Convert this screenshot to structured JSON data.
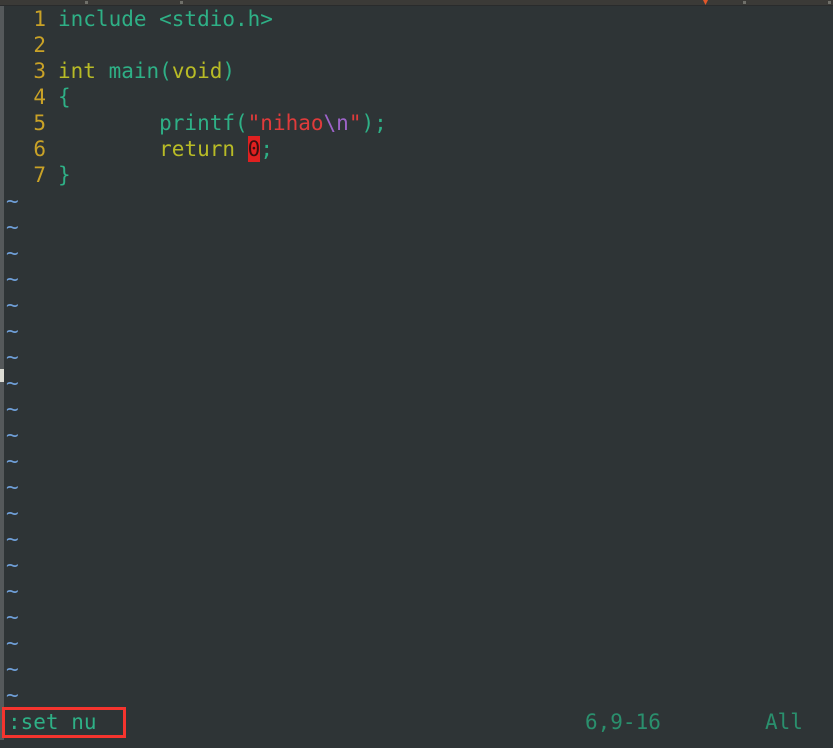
{
  "app": {
    "name": "vim",
    "background_color": "#2e3436",
    "titlebar_color": "#3b3a37"
  },
  "editor": {
    "gutter_color": "#c9a227",
    "lines": [
      {
        "number": "1",
        "text": "include <stdio.h>",
        "tokens": [
          {
            "text": "include <stdio.h>",
            "kind": "plain"
          }
        ]
      },
      {
        "number": "2",
        "text": "",
        "tokens": []
      },
      {
        "number": "3",
        "text": "int main(void)",
        "tokens": [
          {
            "text": "int",
            "kind": "keyword"
          },
          {
            "text": " ",
            "kind": "plain"
          },
          {
            "text": "main(",
            "kind": "func"
          },
          {
            "text": "void",
            "kind": "keyword"
          },
          {
            "text": ")",
            "kind": "punct"
          }
        ]
      },
      {
        "number": "4",
        "text": "{",
        "tokens": [
          {
            "text": "{",
            "kind": "punct"
          }
        ]
      },
      {
        "number": "5",
        "text": "        printf(\"nihao\\n\");",
        "tokens": [
          {
            "text": "        printf(",
            "kind": "func"
          },
          {
            "text": "\"nihao",
            "kind": "string"
          },
          {
            "text": "\\n",
            "kind": "escape"
          },
          {
            "text": "\"",
            "kind": "string"
          },
          {
            "text": ");",
            "kind": "punct"
          }
        ]
      },
      {
        "number": "6",
        "text": "        return 0;",
        "tokens": [
          {
            "text": "        ",
            "kind": "plain"
          },
          {
            "text": "return",
            "kind": "keyword"
          },
          {
            "text": " ",
            "kind": "plain"
          },
          {
            "text": "0",
            "kind": "cursor"
          },
          {
            "text": ";",
            "kind": "punct"
          }
        ]
      },
      {
        "number": "7",
        "text": "}",
        "tokens": [
          {
            "text": "}",
            "kind": "punct"
          }
        ]
      }
    ],
    "filler_marker": "~",
    "filler_count": 20,
    "filler_color": "#6f9fd8"
  },
  "cursor": {
    "character": "0",
    "block_color": "#e02020",
    "line": 6,
    "column": 9
  },
  "statusline": {
    "command": ":set nu",
    "command_color": "#2eb086",
    "ruler": "6,9-16",
    "scroll_position": "All",
    "info_color": "#2a8f6d"
  },
  "annotation": {
    "type": "highlight-rectangle",
    "color": "#f5342e",
    "target": ":set nu"
  }
}
